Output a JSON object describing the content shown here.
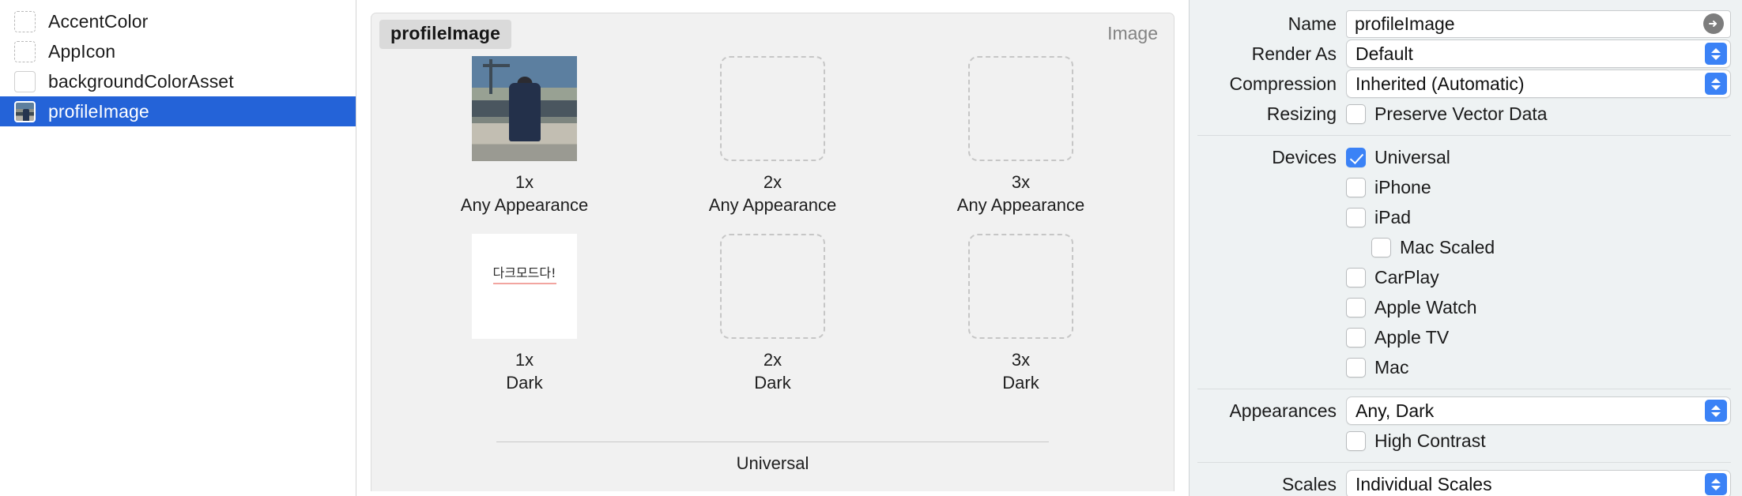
{
  "sidebar": {
    "items": [
      {
        "label": "AccentColor",
        "icon": "dashed-placeholder-icon",
        "selected": false
      },
      {
        "label": "AppIcon",
        "icon": "dashed-placeholder-icon",
        "selected": false
      },
      {
        "label": "backgroundColorAsset",
        "icon": "color-swatch-icon",
        "selected": false
      },
      {
        "label": "profileImage",
        "icon": "image-thumbnail-icon",
        "selected": true
      }
    ]
  },
  "canvas": {
    "title": "profileImage",
    "kind": "Image",
    "footer": "Universal",
    "rows": [
      {
        "appearance": "Any Appearance",
        "slots": [
          {
            "scale": "1x",
            "appearance": "Any Appearance",
            "filled": true,
            "content": "photo"
          },
          {
            "scale": "2x",
            "appearance": "Any Appearance",
            "filled": false,
            "content": ""
          },
          {
            "scale": "3x",
            "appearance": "Any Appearance",
            "filled": false,
            "content": ""
          }
        ]
      },
      {
        "appearance": "Dark",
        "slots": [
          {
            "scale": "1x",
            "appearance": "Dark",
            "filled": true,
            "content": "다크모드다!"
          },
          {
            "scale": "2x",
            "appearance": "Dark",
            "filled": false,
            "content": ""
          },
          {
            "scale": "3x",
            "appearance": "Dark",
            "filled": false,
            "content": ""
          }
        ]
      }
    ]
  },
  "inspector": {
    "name_label": "Name",
    "name_value": "profileImage",
    "render_as_label": "Render As",
    "render_as_value": "Default",
    "compression_label": "Compression",
    "compression_value": "Inherited (Automatic)",
    "resizing_label": "Resizing",
    "preserve_vector_label": "Preserve Vector Data",
    "preserve_vector_checked": false,
    "devices_label": "Devices",
    "devices": [
      {
        "label": "Universal",
        "checked": true,
        "indent": false
      },
      {
        "label": "iPhone",
        "checked": false,
        "indent": false
      },
      {
        "label": "iPad",
        "checked": false,
        "indent": false
      },
      {
        "label": "Mac Scaled",
        "checked": false,
        "indent": true
      },
      {
        "label": "CarPlay",
        "checked": false,
        "indent": false
      },
      {
        "label": "Apple Watch",
        "checked": false,
        "indent": false
      },
      {
        "label": "Apple TV",
        "checked": false,
        "indent": false
      },
      {
        "label": "Mac",
        "checked": false,
        "indent": false
      }
    ],
    "appearances_label": "Appearances",
    "appearances_value": "Any, Dark",
    "high_contrast_label": "High Contrast",
    "high_contrast_checked": false,
    "scales_label": "Scales",
    "scales_value": "Individual Scales"
  },
  "colors": {
    "accent": "#2463d8",
    "control_blue": "#3b82f6",
    "canvas_bg": "#f1f1f1",
    "inspector_bg": "#eef2f3"
  }
}
